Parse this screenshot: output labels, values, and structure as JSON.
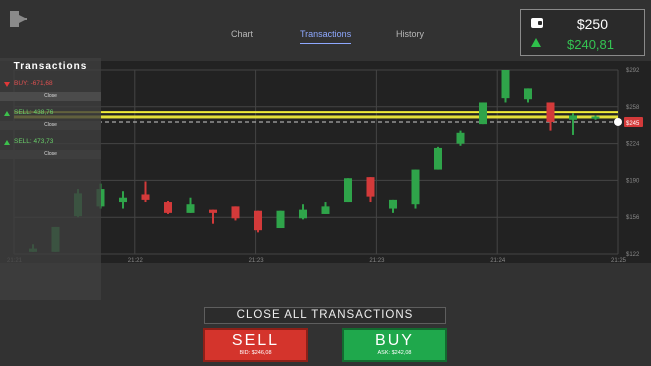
{
  "nav": {
    "tabs": [
      {
        "label": "Chart",
        "active": false
      },
      {
        "label": "Transactions",
        "active": true
      },
      {
        "label": "History",
        "active": false
      }
    ]
  },
  "account": {
    "balance": "$250",
    "equity": "$240,81",
    "icons": {
      "wallet": "wallet-icon",
      "trend": "up-arrow-icon",
      "exit": "exit-icon"
    }
  },
  "panel": {
    "title": "Transactions",
    "items": [
      {
        "label": "BUY: -671,68",
        "direction": "down",
        "close_label": "Close"
      },
      {
        "label": "SELL: 438,76",
        "direction": "up",
        "close_label": "Close"
      },
      {
        "label": "SELL: 473,73",
        "direction": "up",
        "close_label": "Close"
      }
    ]
  },
  "actions": {
    "close_all_label": "CLOSE ALL TRANSACTIONS",
    "sell_label": "SELL",
    "sell_bid": "BID: $246,08",
    "buy_label": "BUY",
    "buy_ask": "ASK: $242,08"
  },
  "chart_data": {
    "type": "candlestick",
    "y_ticks": [
      "$292",
      "$258",
      "$224",
      "$190",
      "$156",
      "$122"
    ],
    "x_ticks": [
      "21:21",
      "21:22",
      "21:23",
      "21:23",
      "21:24",
      "21:25"
    ],
    "current_price_label": "$245",
    "ylim": [
      122,
      292
    ],
    "grid": true,
    "colors": {
      "up": "#2fa44a",
      "down": "#d33a3a",
      "price_line": "#e6e03a"
    },
    "candles": [
      {
        "open": 124,
        "close": 127,
        "high": 131,
        "low": 124
      },
      {
        "open": 124,
        "close": 147,
        "high": 147,
        "low": 124
      },
      {
        "open": 157,
        "close": 178,
        "high": 182,
        "low": 156
      },
      {
        "open": 166,
        "close": 182,
        "high": 187,
        "low": 164
      },
      {
        "open": 170,
        "close": 174,
        "high": 180,
        "low": 164
      },
      {
        "open": 177,
        "close": 172,
        "high": 189,
        "low": 170
      },
      {
        "open": 170,
        "close": 160,
        "high": 171,
        "low": 159
      },
      {
        "open": 160,
        "close": 168,
        "high": 174,
        "low": 160
      },
      {
        "open": 163,
        "close": 160,
        "high": 163,
        "low": 150
      },
      {
        "open": 166,
        "close": 155,
        "high": 166,
        "low": 153
      },
      {
        "open": 162,
        "close": 144,
        "high": 162,
        "low": 142
      },
      {
        "open": 146,
        "close": 162,
        "high": 162,
        "low": 146
      },
      {
        "open": 155,
        "close": 163,
        "high": 168,
        "low": 154
      },
      {
        "open": 159,
        "close": 166,
        "high": 170,
        "low": 159
      },
      {
        "open": 170,
        "close": 192,
        "high": 192,
        "low": 170
      },
      {
        "open": 193,
        "close": 175,
        "high": 193,
        "low": 170
      },
      {
        "open": 164,
        "close": 172,
        "high": 172,
        "low": 160
      },
      {
        "open": 168,
        "close": 200,
        "high": 200,
        "low": 164
      },
      {
        "open": 200,
        "close": 220,
        "high": 221,
        "low": 200
      },
      {
        "open": 224,
        "close": 234,
        "high": 236,
        "low": 222
      },
      {
        "open": 242,
        "close": 262,
        "high": 262,
        "low": 242
      },
      {
        "open": 266,
        "close": 292,
        "high": 292,
        "low": 262
      },
      {
        "open": 265,
        "close": 275,
        "high": 275,
        "low": 262
      },
      {
        "open": 262,
        "close": 244,
        "high": 262,
        "low": 236
      },
      {
        "open": 246,
        "close": 250,
        "high": 252,
        "low": 232
      },
      {
        "open": 247,
        "close": 249,
        "high": 250,
        "low": 246
      }
    ]
  }
}
